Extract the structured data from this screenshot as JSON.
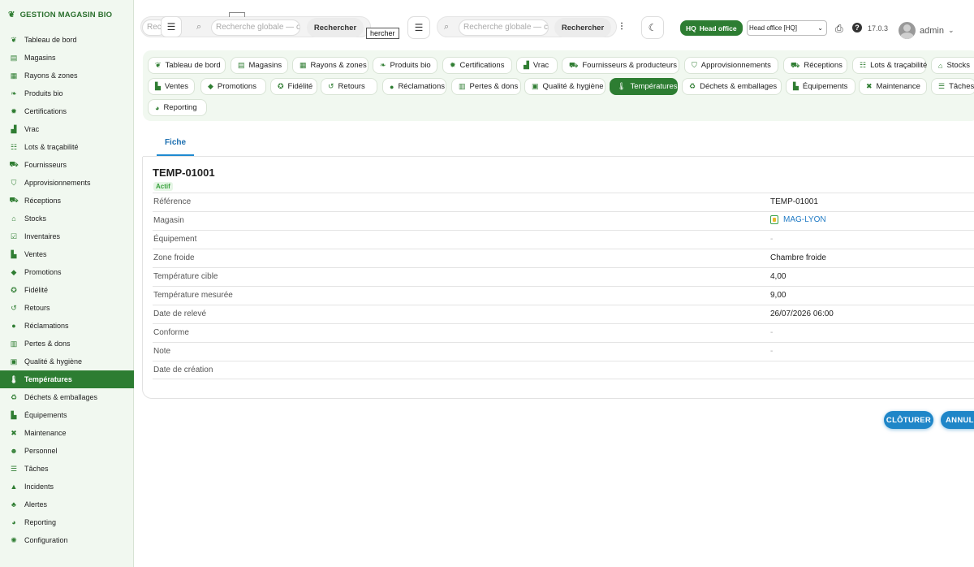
{
  "app": {
    "brand": "GESTION MAGASIN BIO"
  },
  "sidebar": {
    "items": [
      {
        "label": "Tableau de bord",
        "icon": "seedling-icon",
        "glyph": "❦"
      },
      {
        "label": "Magasins",
        "icon": "store-icon",
        "glyph": "▤"
      },
      {
        "label": "Rayons & zones",
        "icon": "grid-icon",
        "glyph": "▦"
      },
      {
        "label": "Produits bio",
        "icon": "leaf-icon",
        "glyph": "❧"
      },
      {
        "label": "Certifications",
        "icon": "certificate-icon",
        "glyph": "✹"
      },
      {
        "label": "Vrac",
        "icon": "boxes-icon",
        "glyph": "▟"
      },
      {
        "label": "Lots & traçabilité",
        "icon": "list-icon",
        "glyph": "☷"
      },
      {
        "label": "Fournisseurs",
        "icon": "truck-icon",
        "glyph": "⛟"
      },
      {
        "label": "Approvisionnements",
        "icon": "cart-icon",
        "glyph": "⛉"
      },
      {
        "label": "Réceptions",
        "icon": "delivery-icon",
        "glyph": "⛟"
      },
      {
        "label": "Stocks",
        "icon": "warehouse-icon",
        "glyph": "⌂"
      },
      {
        "label": "Inventaires",
        "icon": "clipboard-check-icon",
        "glyph": "☑"
      },
      {
        "label": "Ventes",
        "icon": "cash-register-icon",
        "glyph": "▙"
      },
      {
        "label": "Promotions",
        "icon": "tags-icon",
        "glyph": "◆"
      },
      {
        "label": "Fidélité",
        "icon": "award-icon",
        "glyph": "✪"
      },
      {
        "label": "Retours",
        "icon": "undo-icon",
        "glyph": "↺"
      },
      {
        "label": "Réclamations",
        "icon": "comment-icon",
        "glyph": "●"
      },
      {
        "label": "Pertes & dons",
        "icon": "trash-icon",
        "glyph": "▥"
      },
      {
        "label": "Qualité & hygiène",
        "icon": "clipboard-icon",
        "glyph": "▣"
      },
      {
        "label": "Températures",
        "icon": "thermometer-icon",
        "glyph": "🌡"
      },
      {
        "label": "Déchets & emballages",
        "icon": "recycle-icon",
        "glyph": "♻"
      },
      {
        "label": "Équipements",
        "icon": "equipment-icon",
        "glyph": "▙"
      },
      {
        "label": "Maintenance",
        "icon": "tools-icon",
        "glyph": "✖"
      },
      {
        "label": "Personnel",
        "icon": "users-icon",
        "glyph": "☻"
      },
      {
        "label": "Tâches",
        "icon": "tasks-icon",
        "glyph": "☰"
      },
      {
        "label": "Incidents",
        "icon": "warning-icon",
        "glyph": "▲"
      },
      {
        "label": "Alertes",
        "icon": "bell-icon",
        "glyph": "♣"
      },
      {
        "label": "Reporting",
        "icon": "chart-pie-icon",
        "glyph": "◕"
      },
      {
        "label": "Configuration",
        "icon": "gear-icon",
        "glyph": "✺"
      }
    ],
    "active_index": 19
  },
  "topbar": {
    "search_placeholder_1": "Recherche g",
    "search_placeholder_2": "Recherche globale — cl",
    "search_placeholder_3": "Recherche globale — cl",
    "search_button": "Rechercher",
    "stray_button": "hercher",
    "hq_badge_code": "HQ",
    "hq_badge_label": "Head office",
    "office_select_value": "Head office [HQ]",
    "version": "17.0.3",
    "user": "admin"
  },
  "modules": [
    {
      "label": "Tableau de bord",
      "glyph": "❦"
    },
    {
      "label": "Magasins",
      "glyph": "▤"
    },
    {
      "label": "Rayons & zones",
      "glyph": "▦"
    },
    {
      "label": "Produits bio",
      "glyph": "❧"
    },
    {
      "label": "Certifications",
      "glyph": "✹"
    },
    {
      "label": "Vrac",
      "glyph": "▟"
    },
    {
      "label": "Fournisseurs & producteurs",
      "glyph": "⛟"
    },
    {
      "label": "Approvisionnements",
      "glyph": "⛉"
    },
    {
      "label": "Réceptions",
      "glyph": "⛟"
    },
    {
      "label": "Lots & traçabilité",
      "glyph": "☷"
    },
    {
      "label": "Stocks",
      "glyph": "⌂"
    },
    {
      "label": "Ventes",
      "glyph": "▙"
    },
    {
      "label": "Promotions",
      "glyph": "◆"
    },
    {
      "label": "Fidélité",
      "glyph": "✪"
    },
    {
      "label": "Retours",
      "glyph": "↺"
    },
    {
      "label": "Réclamations",
      "glyph": "●"
    },
    {
      "label": "Pertes & dons",
      "glyph": "▥"
    },
    {
      "label": "Qualité & hygiène",
      "glyph": "▣"
    },
    {
      "label": "Températures",
      "glyph": "🌡"
    },
    {
      "label": "Déchets & emballages",
      "glyph": "♻"
    },
    {
      "label": "Équipements",
      "glyph": "▙"
    },
    {
      "label": "Maintenance",
      "glyph": "✖"
    },
    {
      "label": "Tâches",
      "glyph": "☰"
    },
    {
      "label": "Reporting",
      "glyph": "◕"
    }
  ],
  "record": {
    "tab": "Fiche",
    "title": "TEMP-01001",
    "status": "Actif",
    "fields": [
      {
        "label": "Référence",
        "value": "TEMP-01001",
        "kind": "text"
      },
      {
        "label": "Magasin",
        "value": "MAG-LYON",
        "kind": "link"
      },
      {
        "label": "Équipement",
        "value": "-",
        "kind": "dash"
      },
      {
        "label": "Zone froide",
        "value": "Chambre froide",
        "kind": "text"
      },
      {
        "label": "Température cible",
        "value": "4,00",
        "kind": "text"
      },
      {
        "label": "Température mesurée",
        "value": "9,00",
        "kind": "text"
      },
      {
        "label": "Date de relevé",
        "value": "26/07/2026 06:00",
        "kind": "text"
      },
      {
        "label": "Conforme",
        "value": "-",
        "kind": "dash"
      },
      {
        "label": "Note",
        "value": "-",
        "kind": "dash"
      },
      {
        "label": "Date de création",
        "value": "",
        "kind": "text"
      }
    ]
  },
  "actions": {
    "close": "CLÔTURER",
    "cancel": "ANNULE"
  },
  "colors": {
    "brand_green": "#2d7d32",
    "accent_blue": "#1f86c8",
    "sidebar_bg": "#f1f8f0"
  }
}
